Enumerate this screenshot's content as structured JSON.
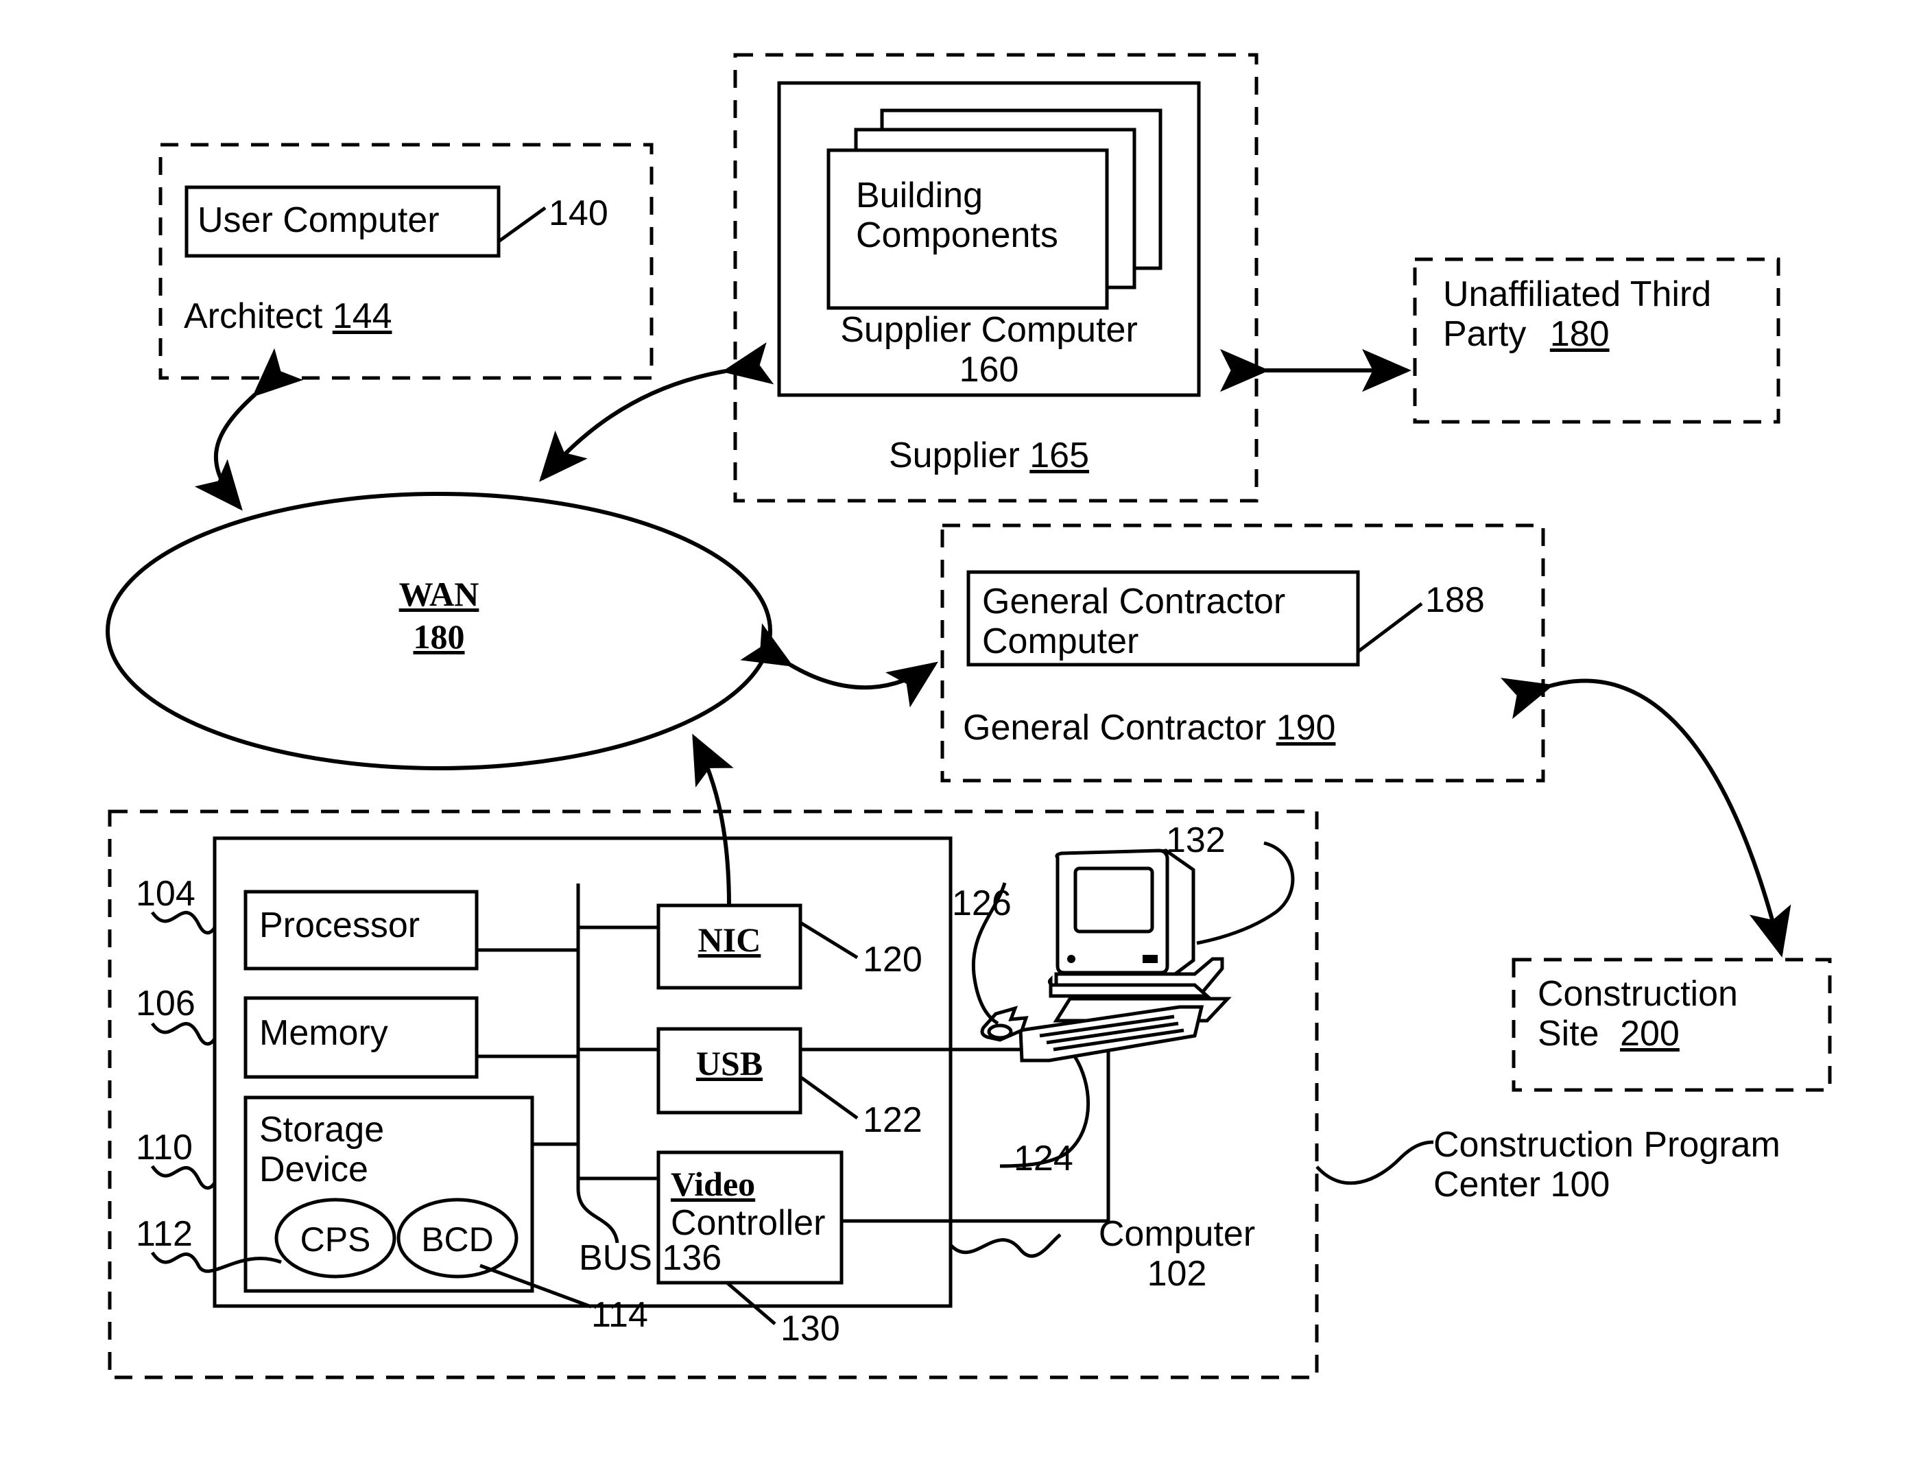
{
  "figure": {
    "type": "patent-block-diagram",
    "title": "Construction Program Center network diagram"
  },
  "architect_group": {
    "container_label": "Architect",
    "container_ref": "144",
    "box_label": "User Computer",
    "box_ref": "140"
  },
  "supplier_group": {
    "container_label": "Supplier",
    "container_ref": "165",
    "computer_label_line1": "Supplier Computer",
    "computer_label_line2": "160",
    "stack_label_line1": "Building",
    "stack_label_line2": "Components"
  },
  "third_party": {
    "line1": "Unaffiliated Third",
    "line2": "Party",
    "ref": "180"
  },
  "wan": {
    "name": "WAN",
    "ref": "180"
  },
  "general_contractor": {
    "container_label": "General Contractor",
    "container_ref": "190",
    "box_line1": "General Contractor",
    "box_line2": "Computer",
    "box_ref": "188"
  },
  "construction_site": {
    "line1": "Construction",
    "line2": "Site",
    "ref": "200"
  },
  "program_center": {
    "line1": "Construction Program",
    "line2": "Center 100"
  },
  "computer": {
    "label_line1": "Computer",
    "label_line2": "102",
    "bus_label": "BUS 136",
    "components": [
      {
        "label": "Processor",
        "ref": "104"
      },
      {
        "label": "Memory",
        "ref": "106"
      },
      {
        "label_line1": "Storage",
        "label_line2": "Device",
        "ref": "110"
      }
    ],
    "storage_items": [
      {
        "label": "CPS",
        "ref": "112"
      },
      {
        "label": "BCD",
        "ref": "114"
      }
    ],
    "io": [
      {
        "label": "NIC",
        "ref": "120"
      },
      {
        "label": "USB",
        "ref": "122"
      },
      {
        "label_line1": "Video",
        "label_line2": "Controller",
        "ref": "130"
      }
    ],
    "peripheral_refs": {
      "mouse": "126",
      "keyboard": "124",
      "monitor": "132"
    }
  },
  "colors": {
    "ink": "#000000",
    "paper": "#ffffff"
  }
}
